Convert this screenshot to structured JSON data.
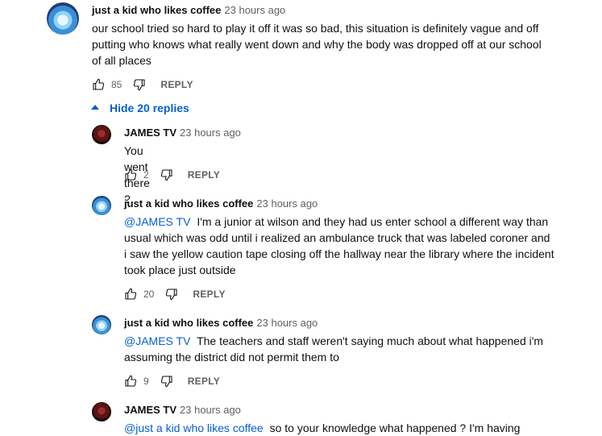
{
  "top_comment": {
    "author": "just a kid who likes coffee",
    "time": "23 hours ago",
    "text": "our school tried so hard to play it off it was so bad, this situation is definitely vague and off putting who knows what really went down and why the body was dropped off at our school of all places",
    "likes": "85",
    "reply_label": "REPLY"
  },
  "hide_replies_label": "Hide 20 replies",
  "replies": [
    {
      "author": "JAMES TV",
      "time": "23 hours ago",
      "mention": "",
      "text": "You went there ?",
      "likes": "2",
      "reply_label": "REPLY"
    },
    {
      "author": "just a kid who likes coffee",
      "time": "23 hours ago",
      "mention": "@JAMES TV",
      "text": "I'm a junior at wilson and they had us enter school a different way than usual which was odd until i realized an ambulance truck that was labeled coroner and i saw the yellow caution tape closing off the hallway near the library where the incident took place just outside",
      "likes": "20",
      "reply_label": "REPLY"
    },
    {
      "author": "just a kid who likes coffee",
      "time": "23 hours ago",
      "mention": "@JAMES TV",
      "text": "The teachers and staff weren't saying much about what happened i'm assuming the district did not permit them to",
      "likes": "9",
      "reply_label": "REPLY"
    },
    {
      "author": "JAMES TV",
      "time": "23 hours ago",
      "mention": "@just a kid who likes coffee",
      "text": "so to your knowledge what happened ? I'm having"
    }
  ],
  "colors": {
    "link": "#065fd4",
    "secondary": "#606060",
    "text": "#0f0f0f"
  },
  "icons": {
    "like": "thumb-up-icon",
    "dislike": "thumb-down-icon",
    "collapse": "caret-up-icon"
  }
}
